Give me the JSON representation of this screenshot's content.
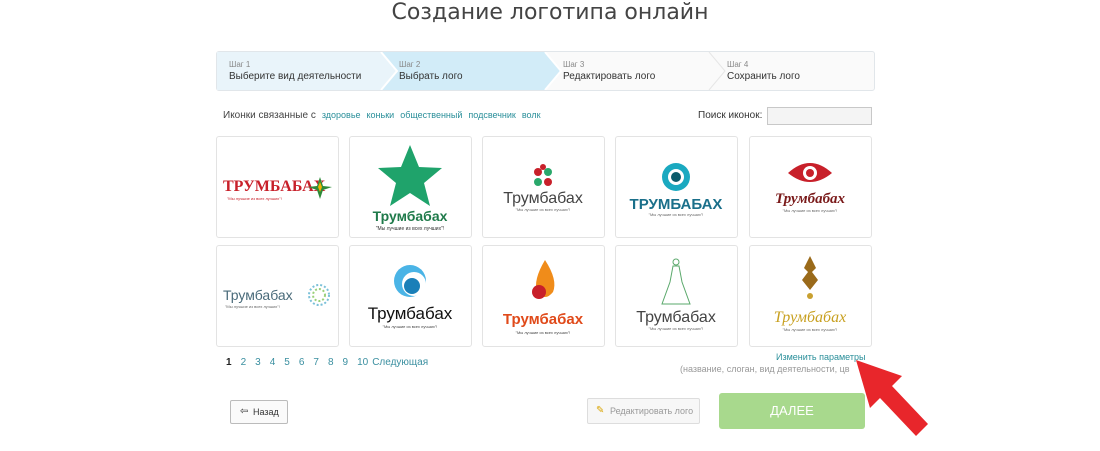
{
  "page": {
    "title": "Создание логотипа онлайн"
  },
  "steps": [
    {
      "num": "Шаг 1",
      "label": "Выберите вид деятельности"
    },
    {
      "num": "Шаг 2",
      "label": "Выбрать лого"
    },
    {
      "num": "Шаг 3",
      "label": "Редактировать лого"
    },
    {
      "num": "Шаг 4",
      "label": "Сохранить лого"
    }
  ],
  "related": {
    "label": "Иконки связанные с",
    "tags": [
      "здоровье",
      "коньки",
      "общественный",
      "подсвечник",
      "волк"
    ]
  },
  "search": {
    "label": "Поиск иконок:",
    "value": ""
  },
  "logos": {
    "brand": "Трумбабах",
    "brand_upper": "ТРУМБАБАХ",
    "slogan": "\"Мы лучшие из всех лучших\"!"
  },
  "pagination": {
    "current": "1",
    "pages": [
      "2",
      "3",
      "4",
      "5",
      "6",
      "7",
      "8",
      "9",
      "10"
    ],
    "next": "Следующая"
  },
  "change_params": {
    "label": "Изменить параметры",
    "sub": "(название, слоган, вид деятельности, цв"
  },
  "buttons": {
    "back": "Назад",
    "edit": "Редактировать лого",
    "next": "ДАЛЕЕ"
  },
  "colors": {
    "accent": "#2a8f9a",
    "next_button": "#a8d98d",
    "arrow": "#e8262b"
  }
}
